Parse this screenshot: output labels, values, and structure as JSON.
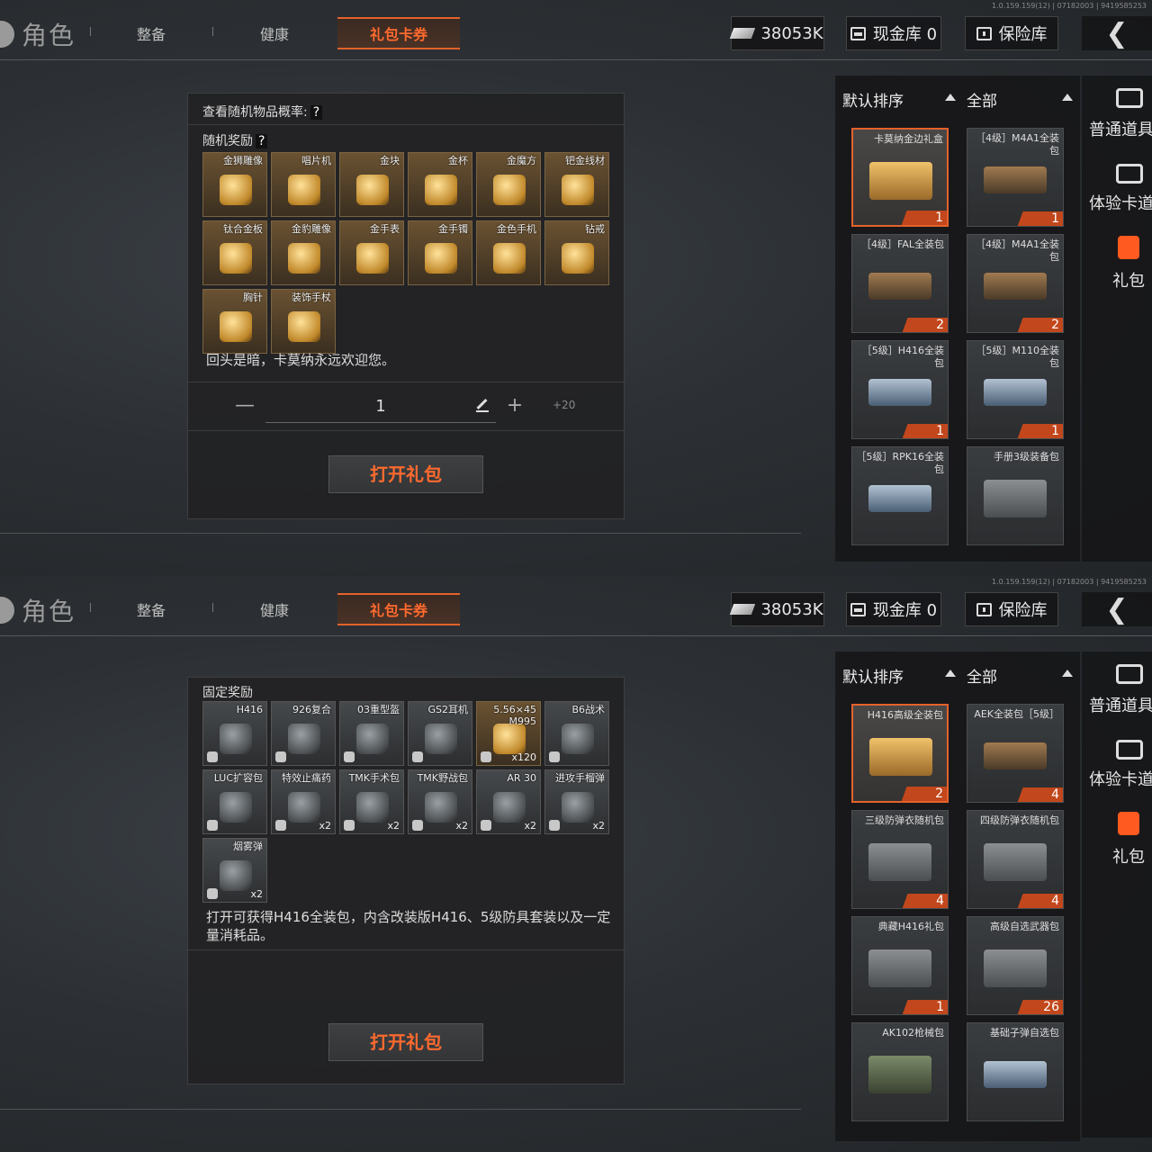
{
  "screens": [
    {
      "version": "1.0.159.159(12) | 07182003 | 9419585253",
      "topbar": {
        "role": "角色",
        "tabs": [
          "整备",
          "健康",
          "礼包卡券"
        ],
        "money": "38053K",
        "cash": "现金库 0",
        "vault": "保险库",
        "back": "❮"
      },
      "panel": {
        "header": "查看随机物品概率:",
        "header_q": "?",
        "section": "随机奖励",
        "section_q": "?",
        "items": [
          {
            "name": "金狮雕像",
            "icon": "lion-statue-icon"
          },
          {
            "name": "唱片机",
            "icon": "record-player-icon"
          },
          {
            "name": "金块",
            "icon": "gold-bar-icon"
          },
          {
            "name": "金杯",
            "icon": "gold-cup-icon"
          },
          {
            "name": "金魔方",
            "icon": "gold-cube-icon"
          },
          {
            "name": "钯金线材",
            "icon": "wire-icon"
          },
          {
            "name": "钛合金板",
            "icon": "plate-icon"
          },
          {
            "name": "金豹雕像",
            "icon": "leopard-statue-icon"
          },
          {
            "name": "金手表",
            "icon": "watch-icon"
          },
          {
            "name": "金手镯",
            "icon": "bracelet-icon"
          },
          {
            "name": "金色手机",
            "icon": "phone-icon"
          },
          {
            "name": "钻戒",
            "icon": "ring-icon"
          },
          {
            "name": "胸针",
            "icon": "brooch-icon"
          },
          {
            "name": "装饰手杖",
            "icon": "cane-icon"
          }
        ],
        "description": "回头是暗，卡莫纳永远欢迎您。",
        "quantity": {
          "minus": "—",
          "value": "1",
          "plus": "+",
          "max": "+20"
        },
        "open_button": "打开礼包"
      },
      "sort": {
        "default": "默认排序",
        "all": "全部"
      },
      "cards": [
        {
          "name": "卡莫纳金边礼盒",
          "count": "1",
          "selected": true,
          "style": "gold"
        },
        {
          "name": "［4级］M4A1全装包",
          "count": "1",
          "style": "gun"
        },
        {
          "name": "［4级］FAL全装包",
          "count": "2",
          "style": "gun"
        },
        {
          "name": "［4级］M4A1全装包",
          "count": "2",
          "style": "gun"
        },
        {
          "name": "［5级］H416全装包",
          "count": "1",
          "style": "blue"
        },
        {
          "name": "［5级］M110全装包",
          "count": "1",
          "style": "blue"
        },
        {
          "name": "［5级］RPK16全装包",
          "count": "",
          "style": "blue"
        },
        {
          "name": "手册3级装备包",
          "count": "",
          "style": "gray"
        }
      ],
      "nav": [
        "普通道具",
        "体验卡道",
        "礼包"
      ]
    },
    {
      "version": "1.0.159.159(12) | 07182003 | 9419585253",
      "topbar": {
        "role": "角色",
        "tabs": [
          "整备",
          "健康",
          "礼包卡券"
        ],
        "money": "38053K",
        "cash": "现金库 0",
        "vault": "保险库",
        "back": "❮"
      },
      "panel": {
        "section": "固定奖励",
        "items": [
          {
            "name": "H416",
            "count": "",
            "icon": "rifle-icon"
          },
          {
            "name": "926复合",
            "count": "",
            "icon": "vest-icon"
          },
          {
            "name": "03重型盔",
            "count": "",
            "icon": "helmet-icon"
          },
          {
            "name": "GS2耳机",
            "count": "",
            "icon": "headset-icon"
          },
          {
            "name": "5.56×45 M995",
            "count": "x120",
            "icon": "ammo-icon",
            "gold": true
          },
          {
            "name": "B6战术",
            "count": "",
            "icon": "tactical-vest-icon"
          },
          {
            "name": "LUC扩容包",
            "count": "",
            "icon": "backpack-icon"
          },
          {
            "name": "特效止痛药",
            "count": "x2",
            "icon": "pill-jar-icon"
          },
          {
            "name": "TMK手术包",
            "count": "x2",
            "icon": "surgery-kit-icon"
          },
          {
            "name": "TMK野战包",
            "count": "x2",
            "icon": "field-kit-icon"
          },
          {
            "name": "AR 30",
            "count": "x2",
            "icon": "magazine-icon"
          },
          {
            "name": "进攻手榴弹",
            "count": "x2",
            "icon": "grenade-icon"
          },
          {
            "name": "烟雾弹",
            "count": "x2",
            "icon": "smoke-grenade-icon"
          }
        ],
        "description": "打开可获得H416全装包，内含改装版H416、5级防具套装以及一定量消耗品。",
        "open_button": "打开礼包"
      },
      "sort": {
        "default": "默认排序",
        "all": "全部"
      },
      "cards": [
        {
          "name": "H416高级全装包",
          "count": "2",
          "selected": true,
          "style": "gold"
        },
        {
          "name": "AEK全装包［5级］",
          "count": "4",
          "style": "gun"
        },
        {
          "name": "三级防弹衣随机包",
          "count": "4",
          "style": "gray"
        },
        {
          "name": "四级防弹衣随机包",
          "count": "4",
          "style": "gray"
        },
        {
          "name": "典藏H416礼包",
          "count": "1",
          "style": "gray"
        },
        {
          "name": "高级自选武器包",
          "count": "26",
          "style": "gray"
        },
        {
          "name": "AK102枪械包",
          "count": "",
          "style": "green"
        },
        {
          "name": "基础子弹自选包",
          "count": "",
          "style": "blue"
        }
      ],
      "nav": [
        "普通道具",
        "体验卡道",
        "礼包"
      ]
    }
  ],
  "colors": {
    "accent": "#e4622c",
    "accent_text": "#ff6a2e",
    "panel": "#222224"
  }
}
